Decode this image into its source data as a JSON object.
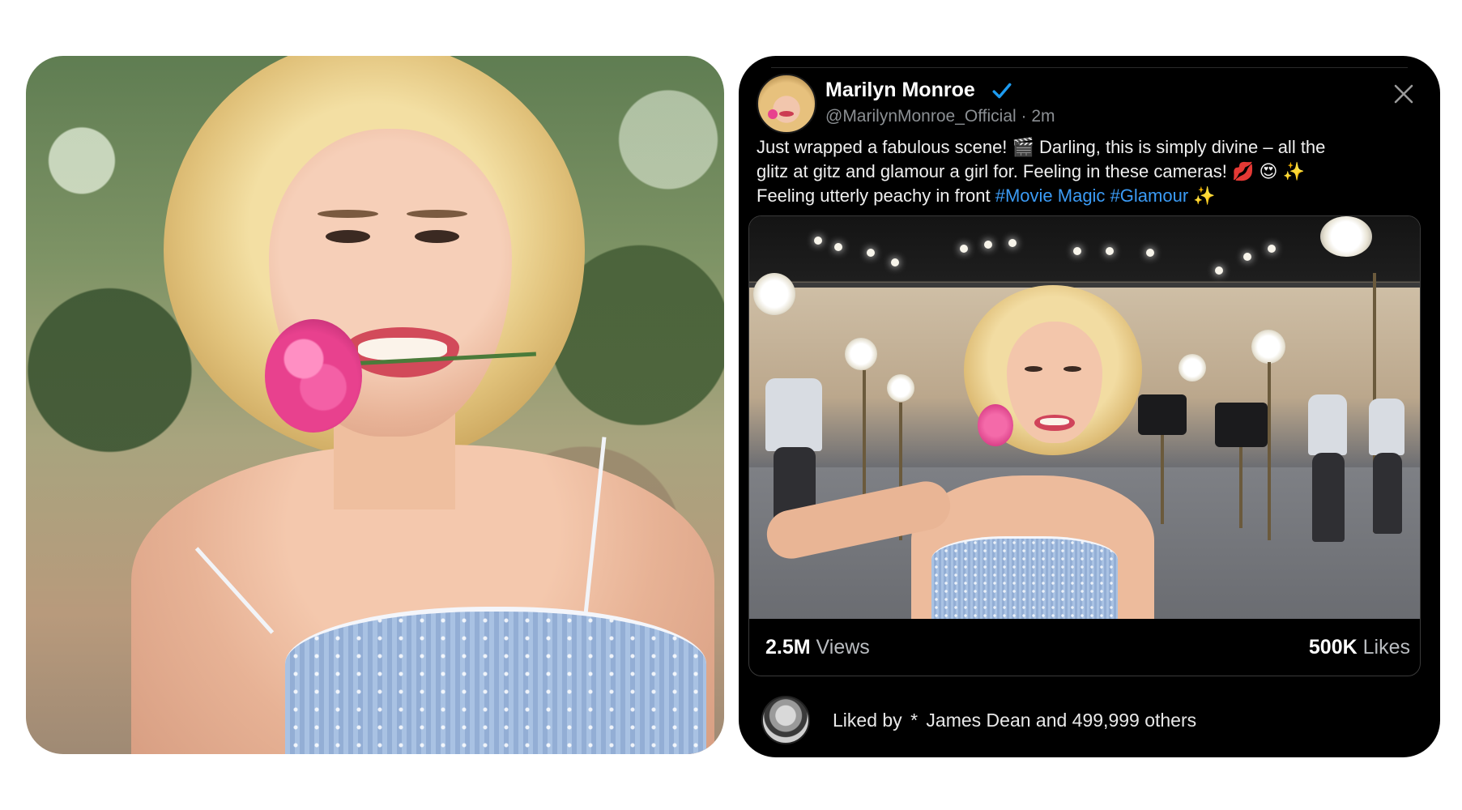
{
  "tweet": {
    "display_name": "Marilyn Monroe",
    "handle": "@MarilynMonroe_Official",
    "separator": "·",
    "time": "2m",
    "verified": true,
    "lines": [
      "Just wrapped a fabulous scene! 🎬 Darling, this is simply divine – all the",
      "glitz at gitz and glamour a girl for. Feeling in these cameras! 💋 😍 ✨"
    ],
    "line3_prefix": "Feeling utterly peachy in front ",
    "hashtags": [
      "#Movie Magic",
      "#Glamour"
    ],
    "line3_suffix": " ✨",
    "stats": {
      "views_value": "2.5M",
      "views_label": "Views",
      "likes_value": "500K",
      "likes_label": "Likes"
    },
    "liked_by": {
      "prefix": "Liked by",
      "star": "*",
      "text": "James Dean and 499,999 others"
    }
  },
  "icons": {
    "verified": "verified-badge-icon",
    "close": "close-icon"
  },
  "colors": {
    "card_bg": "#000000",
    "hashtag": "#3b9bf5",
    "verified": "#1d9bf0",
    "muted_text": "#8b8f93"
  }
}
